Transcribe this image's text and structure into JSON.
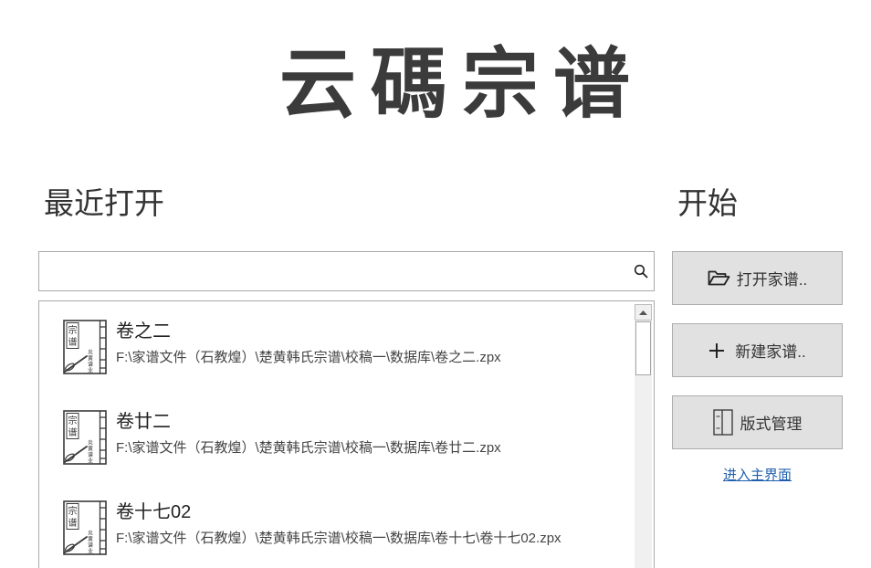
{
  "logo": {
    "text": "云碼宗谱"
  },
  "recent": {
    "heading": "最近打开",
    "items": [
      {
        "title": "卷之二",
        "path": "F:\\家谱文件（石教煌）\\楚黄韩氏宗谱\\校稿一\\数据库\\卷之二.zpx"
      },
      {
        "title": "卷廿二",
        "path": "F:\\家谱文件（石教煌）\\楚黄韩氏宗谱\\校稿一\\数据库\\卷廿二.zpx"
      },
      {
        "title": "卷十七02",
        "path": "F:\\家谱文件（石教煌）\\楚黄韩氏宗谱\\校稿一\\数据库\\卷十七\\卷十七02.zpx"
      }
    ]
  },
  "file_icon": {
    "icon": "family-book-icon",
    "title": [
      "宗",
      "谱"
    ],
    "brand": [
      "炎",
      "黄",
      "谱",
      "业"
    ]
  },
  "start": {
    "heading": "开始",
    "buttons": [
      {
        "label": "打开家谱..",
        "icon": "folder-open-icon"
      },
      {
        "label": "新建家谱..",
        "icon": "plus-icon"
      },
      {
        "label": "版式管理",
        "icon": "layout-icon"
      }
    ],
    "main_link": "进入主界面"
  },
  "colors": {
    "text": "#333333",
    "button_bg": "#e1e1e1",
    "button_border": "#adadad",
    "link": "#1f5fae",
    "border": "#a9a9a9"
  }
}
